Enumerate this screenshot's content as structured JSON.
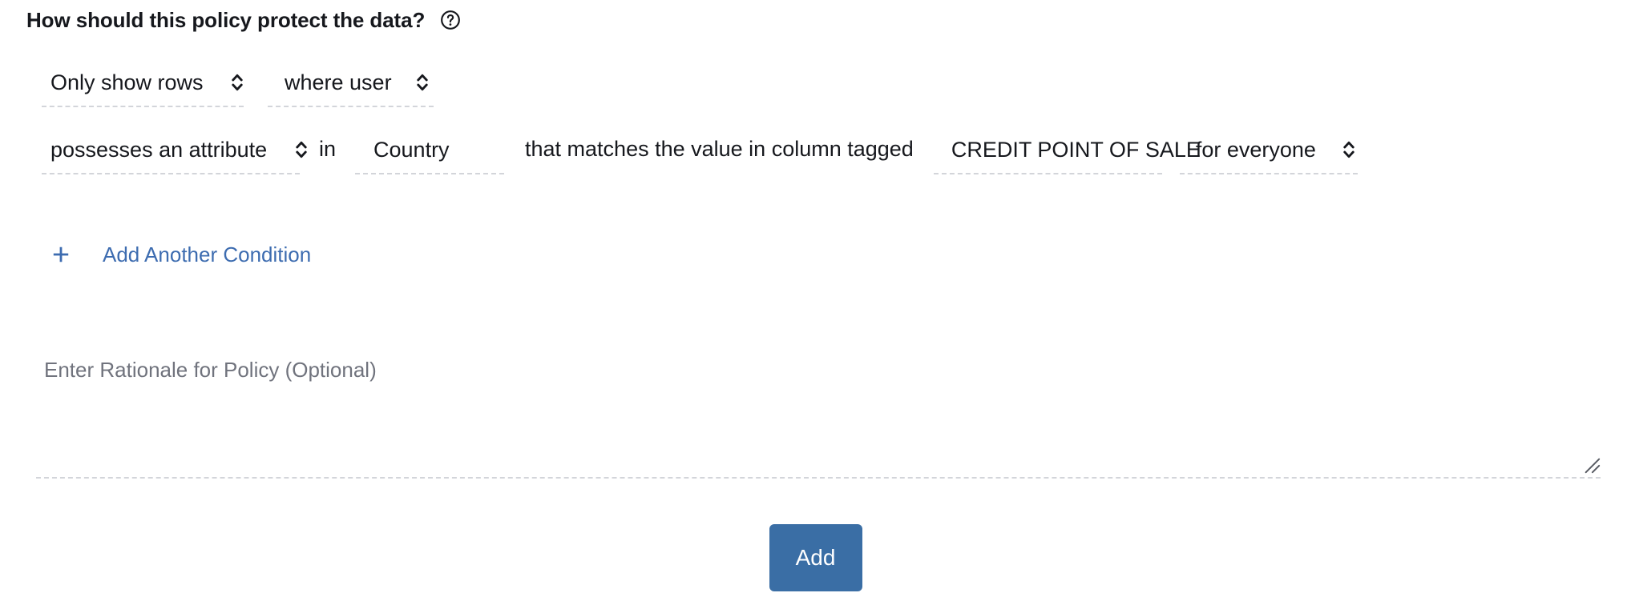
{
  "heading": {
    "title": "How should this policy protect the data?",
    "help_icon": "help-circle-icon"
  },
  "condition_builder": {
    "rows": [
      {
        "fields": [
          {
            "name": "policy-action",
            "value": "Only show rows",
            "icon": "chevron-up-down-icon"
          },
          {
            "name": "policy-subject",
            "value": "where user",
            "icon": "chevron-up-down-icon"
          }
        ]
      },
      {
        "fields": [
          {
            "name": "policy-operator",
            "value": "possesses an attribute",
            "icon": "chevron-up-down-icon"
          },
          {
            "name": "policy-attribute",
            "value": "Country"
          },
          {
            "name": "policy-column-tag",
            "value": "CREDIT POINT OF SALE"
          },
          {
            "name": "policy-scope",
            "value": "for everyone",
            "icon": "chevron-up-down-icon"
          }
        ],
        "connectives": {
          "in": "in",
          "matches": "that matches the value in column tagged"
        }
      }
    ]
  },
  "add_condition": {
    "icon": "plus-icon",
    "label": "Add Another Condition"
  },
  "rationale": {
    "placeholder": "Enter Rationale for Policy (Optional)",
    "value": "",
    "resize_handle": "resize-grip-icon"
  },
  "submit": {
    "label": "Add"
  },
  "colors": {
    "link": "#3d6cb0",
    "button_background": "#3a6ea5",
    "button_text": "#ffffff",
    "text": "#16181d",
    "placeholder": "#70737d",
    "dashed_border": "#d3d5da"
  }
}
